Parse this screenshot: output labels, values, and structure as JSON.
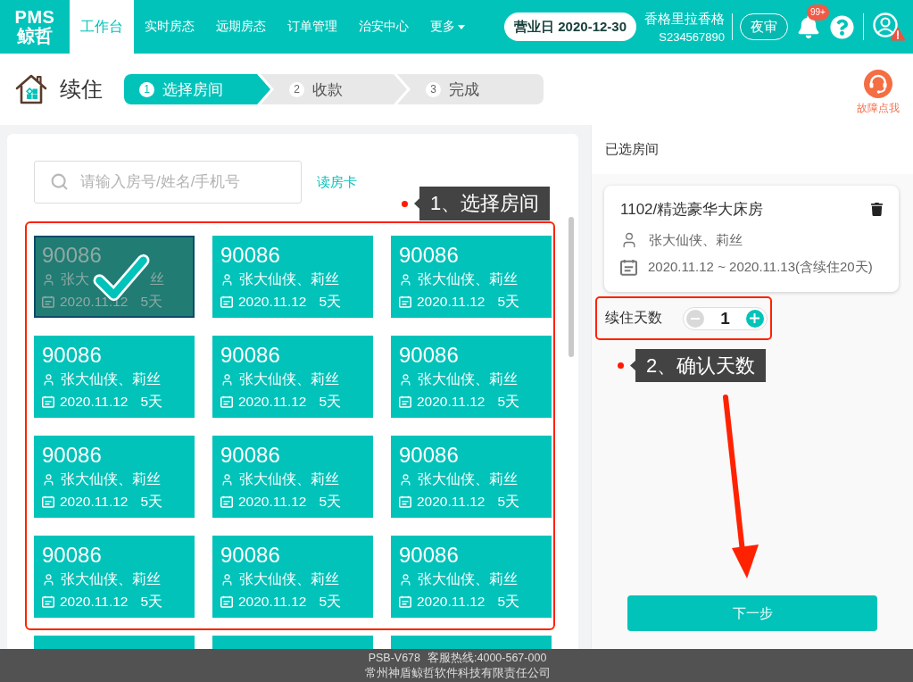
{
  "nav": {
    "logo": [
      "PMS",
      "鲸哲"
    ],
    "tabs": [
      {
        "label": "工作台",
        "selected": true,
        "has_menu": false
      },
      {
        "label": "实时房态",
        "selected": false,
        "has_menu": false
      },
      {
        "label": "远期房态",
        "selected": false,
        "has_menu": false
      },
      {
        "label": "订单管理",
        "selected": false,
        "has_menu": false
      },
      {
        "label": "治安中心",
        "selected": false,
        "has_menu": false
      },
      {
        "label": "更多",
        "selected": false,
        "has_menu": true
      }
    ],
    "business_day": "营业日 2020-12-30",
    "hotel_name": "香格里拉香格",
    "hotel_code": "S234567890",
    "night_audit_button": "夜审",
    "notification_badge": "99+"
  },
  "page": {
    "title": "续住",
    "steps": [
      {
        "number": "1",
        "label": "选择房间",
        "selected": true
      },
      {
        "number": "2",
        "label": "收款",
        "selected": false
      },
      {
        "number": "3",
        "label": "完成",
        "selected": false
      }
    ],
    "support_label": "故障点我"
  },
  "room_panel": {
    "search": {
      "placeholder": "请输入房号/姓名/手机号"
    },
    "read_card_link": "读房卡",
    "annotation": "1、选择房间",
    "rooms": [
      {
        "number": "90086",
        "guests": "张大",
        "guests_tail": "丝",
        "date": "2020.11.12",
        "nights": "5天",
        "selected": true
      },
      {
        "number": "90086",
        "guests": "张大仙侠、莉丝",
        "date": "2020.11.12",
        "nights": "5天",
        "selected": false
      },
      {
        "number": "90086",
        "guests": "张大仙侠、莉丝",
        "date": "2020.11.12",
        "nights": "5天",
        "selected": false
      },
      {
        "number": "90086",
        "guests": "张大仙侠、莉丝",
        "date": "2020.11.12",
        "nights": "5天",
        "selected": false
      },
      {
        "number": "90086",
        "guests": "张大仙侠、莉丝",
        "date": "2020.11.12",
        "nights": "5天",
        "selected": false
      },
      {
        "number": "90086",
        "guests": "张大仙侠、莉丝",
        "date": "2020.11.12",
        "nights": "5天",
        "selected": false
      },
      {
        "number": "90086",
        "guests": "张大仙侠、莉丝",
        "date": "2020.11.12",
        "nights": "5天",
        "selected": false
      },
      {
        "number": "90086",
        "guests": "张大仙侠、莉丝",
        "date": "2020.11.12",
        "nights": "5天",
        "selected": false
      },
      {
        "number": "90086",
        "guests": "张大仙侠、莉丝",
        "date": "2020.11.12",
        "nights": "5天",
        "selected": false
      },
      {
        "number": "90086",
        "guests": "张大仙侠、莉丝",
        "date": "2020.11.12",
        "nights": "5天",
        "selected": false
      },
      {
        "number": "90086",
        "guests": "张大仙侠、莉丝",
        "date": "2020.11.12",
        "nights": "5天",
        "selected": false
      },
      {
        "number": "90086",
        "guests": "张大仙侠、莉丝",
        "date": "2020.11.12",
        "nights": "5天",
        "selected": false
      }
    ]
  },
  "selected_panel": {
    "title": "已选房间",
    "room": {
      "name": "1102/精选豪华大床房",
      "guests": "张大仙侠、莉丝",
      "stay": "2020.11.12 ~ 2020.11.13(含续住20天)"
    },
    "days_label": "续住天数",
    "days_value": "1",
    "decrease_disabled": true,
    "annotation": "2、确认天数",
    "next_button": "下一步"
  },
  "footer": {
    "build": "PSB-V678",
    "hotline": "客服热线:4000-567-000",
    "company": "常州神盾鲸哲软件科技有限责任公司"
  }
}
